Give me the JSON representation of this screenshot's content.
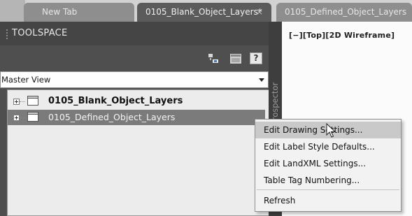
{
  "tabs": {
    "new_tab": "New Tab",
    "active_tab": "0105_Blank_Object_Layers*",
    "active_close": "×",
    "defined_tab": "0105_Defined_Object_Layers"
  },
  "toolspace": {
    "title": "TOOLSPACE",
    "help_label": "?",
    "view_select": "Master View",
    "tree": [
      {
        "label": "0105_Blank_Object_Layers"
      },
      {
        "label": "0105_Defined_Object_Layers"
      }
    ],
    "side_tab": "Prospector"
  },
  "viewport": {
    "label": "[−][Top][2D Wireframe]"
  },
  "context_menu": {
    "items": [
      {
        "label": "Edit Drawing Settings..."
      },
      {
        "label": "Edit Label Style Defaults..."
      },
      {
        "label": "Edit LandXML Settings..."
      },
      {
        "label": "Table Tag Numbering..."
      },
      {
        "label": "Refresh"
      }
    ]
  },
  "icons": {
    "tab_close": "close-icon",
    "toolbar_1": "item-view-icon",
    "toolbar_2": "panel-icon",
    "tree_doc": "drawing-icon",
    "expander": "plus-expander-icon",
    "cursor": "mouse-pointer-icon"
  },
  "colors": {
    "panel_bg": "#4f4f4f",
    "tab_active": "#5b5b5b",
    "selection": "#7b7b7b",
    "menu_highlight": "#c9c9c9"
  }
}
